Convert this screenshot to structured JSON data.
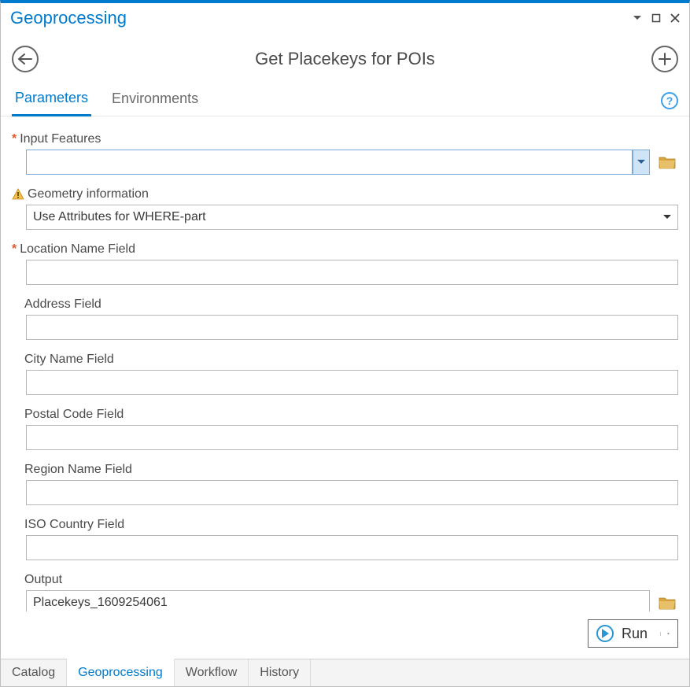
{
  "titlebar": {
    "title": "Geoprocessing"
  },
  "tool": {
    "title": "Get Placekeys for POIs"
  },
  "tabs": {
    "parameters": "Parameters",
    "environments": "Environments"
  },
  "fields": {
    "input_features": {
      "label": "Input Features",
      "value": ""
    },
    "geometry_info": {
      "label": "Geometry information",
      "value": "Use Attributes for WHERE-part"
    },
    "location_name": {
      "label": "Location Name Field",
      "value": ""
    },
    "address": {
      "label": "Address Field",
      "value": ""
    },
    "city": {
      "label": "City Name Field",
      "value": ""
    },
    "postal": {
      "label": "Postal Code Field",
      "value": ""
    },
    "region": {
      "label": "Region Name Field",
      "value": ""
    },
    "iso_country": {
      "label": "ISO Country Field",
      "value": ""
    },
    "output": {
      "label": "Output",
      "value": "Placekeys_1609254061"
    }
  },
  "run_button": {
    "label": "Run"
  },
  "bottom_tabs": {
    "catalog": "Catalog",
    "geoprocessing": "Geoprocessing",
    "workflow": "Workflow",
    "history": "History"
  },
  "help_glyph": "?"
}
